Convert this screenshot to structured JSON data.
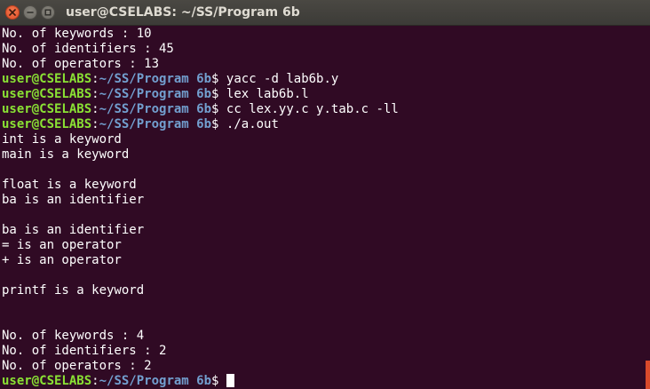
{
  "window": {
    "title": "user@CSELABS: ~/SS/Program 6b",
    "buttons": [
      "close-icon",
      "minimize-icon",
      "maximize-icon"
    ]
  },
  "terminal": {
    "colors": {
      "background": "#300a24",
      "prompt_user": "#8ae234",
      "prompt_path": "#729fcf",
      "text": "#ffffff"
    },
    "lines": [
      {
        "type": "output",
        "text": "No. of keywords : 10"
      },
      {
        "type": "output",
        "text": "No. of identifiers : 45"
      },
      {
        "type": "output",
        "text": "No. of operators : 13"
      },
      {
        "type": "prompt",
        "user": "user@CSELABS",
        "path": "~/SS/Program 6b",
        "symbol": "$",
        "command": "yacc -d lab6b.y"
      },
      {
        "type": "prompt",
        "user": "user@CSELABS",
        "path": "~/SS/Program 6b",
        "symbol": "$",
        "command": "lex lab6b.l"
      },
      {
        "type": "prompt",
        "user": "user@CSELABS",
        "path": "~/SS/Program 6b",
        "symbol": "$",
        "command": "cc lex.yy.c y.tab.c -ll"
      },
      {
        "type": "prompt",
        "user": "user@CSELABS",
        "path": "~/SS/Program 6b",
        "symbol": "$",
        "command": "./a.out"
      },
      {
        "type": "output",
        "text": "int is a keyword"
      },
      {
        "type": "output",
        "text": "main is a keyword"
      },
      {
        "type": "output",
        "text": ""
      },
      {
        "type": "output",
        "text": "float is a keyword"
      },
      {
        "type": "output",
        "text": "ba is an identifier"
      },
      {
        "type": "output",
        "text": ""
      },
      {
        "type": "output",
        "text": "ba is an identifier"
      },
      {
        "type": "output",
        "text": "= is an operator"
      },
      {
        "type": "output",
        "text": "+ is an operator"
      },
      {
        "type": "output",
        "text": ""
      },
      {
        "type": "output",
        "text": "printf is a keyword"
      },
      {
        "type": "output",
        "text": ""
      },
      {
        "type": "output",
        "text": ""
      },
      {
        "type": "output",
        "text": "No. of keywords : 4"
      },
      {
        "type": "output",
        "text": "No. of identifiers : 2"
      },
      {
        "type": "output",
        "text": "No. of operators : 2"
      },
      {
        "type": "prompt",
        "user": "user@CSELABS",
        "path": "~/SS/Program 6b",
        "symbol": "$",
        "command": "",
        "cursor": true
      }
    ]
  }
}
